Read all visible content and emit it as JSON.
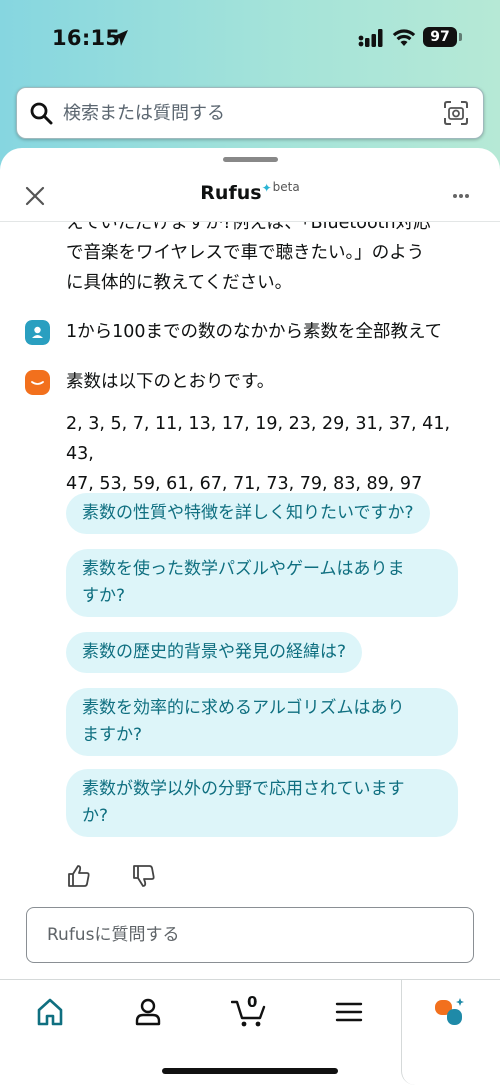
{
  "status_bar": {
    "time": "16:15",
    "battery": "97"
  },
  "search": {
    "placeholder": "検索または質問する"
  },
  "sheet": {
    "title": "Rufus",
    "badge": "beta"
  },
  "chat": {
    "partial_text_line1": "えていただけますか?例えば、「Bluetooth対応",
    "partial_text_line2": "で音楽をワイヤレスで車で聴きたい。」のよう",
    "partial_text_line3": "に具体的に教えてください。",
    "user_message": "1から100までの数のなかから素数を全部教えて",
    "bot_intro": "素数は以下のとおりです。",
    "primes_line1": "2, 3, 5, 7, 11, 13, 17, 19, 23, 29, 31, 37, 41, 43,",
    "primes_line2": "47, 53, 59, 61, 67, 71, 73, 79, 83, 89, 97",
    "suggestions": [
      {
        "line1": "素数の性質や特徴を詳しく知りたいですか?"
      },
      {
        "line1": "素数を使った数学パズルやゲームはありま",
        "line2": "すか?"
      },
      {
        "line1": "素数の歴史的背景や発見の経緯は?"
      },
      {
        "line1": "素数を効率的に求めるアルゴリズムはあり",
        "line2": "ますか?"
      },
      {
        "line1": "素数が数学以外の分野で応用されています",
        "line2": "か?"
      }
    ]
  },
  "ask_input": {
    "placeholder": "Rufusに質問する"
  },
  "nav": {
    "cart_count": "0"
  },
  "colors": {
    "accent_teal": "#0f6f80",
    "chip_bg": "#ddf5f9",
    "rufus_orange": "#f2701d",
    "user_avatar": "#2a9fc0"
  }
}
